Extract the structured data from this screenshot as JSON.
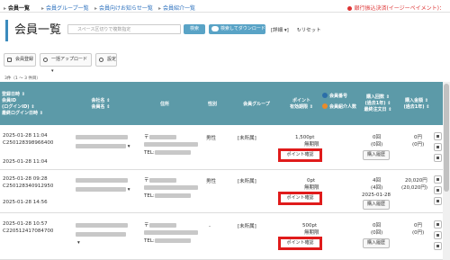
{
  "nav": {
    "items": [
      "会員一覧",
      "会員グループ一覧",
      "会員向けお知らせ一覧",
      "会員紹介一覧"
    ],
    "bank_notice": "銀行振込決済(イージーペイメント)："
  },
  "page_title": "会員一覧",
  "search": {
    "placeholder": "スペース区切りで複数指定",
    "button": "検索",
    "download": "検索してダウンロード",
    "detail": "[詳細 ▾]",
    "reset": "リセット"
  },
  "toolbar": {
    "register": "会員登録",
    "bulk_upload": "一括アップロード ▾",
    "settings": "設定"
  },
  "count_text": "3件（1 〜 3 件目）",
  "table": {
    "headers": {
      "reg": [
        "登録日時 ⇕",
        "会員ID",
        "(ログインID) ⇕",
        "最終ログイン日時 ⇕"
      ],
      "name": [
        "会社名 ⇕",
        "会員名 ⇕"
      ],
      "address": "住所",
      "gender": "性別",
      "group": "会員グループ",
      "point": [
        "ポイント",
        "有効期限 ⇕"
      ],
      "member_no": "会員番号",
      "company_member": "会員紹介人数",
      "purchase_count": [
        "購入回数 ⇕",
        "(過去1年) ⇕",
        "最終注文日 ⇕"
      ],
      "purchase_amount": [
        "購入金額 ⇕",
        "(過去1年) ⇕"
      ]
    },
    "rows": [
      {
        "reg_date": "2025-01-28 11:04",
        "member_id": "C2501283989664​00",
        "last_login": "2025-01-28 11:04",
        "postal": "〒",
        "tel": "TEL:",
        "gender": "男性",
        "group": "[未所属]",
        "point": "1,500pt",
        "point_exp": "無期限",
        "point_btn": "ポイント確認",
        "count": "0回",
        "count_year": "(0回)",
        "last_order": "",
        "amount": "0円",
        "amount_year": "(0円)",
        "hist_btn": "購入履歴"
      },
      {
        "reg_date": "2025-01-28 09:28",
        "member_id": "C2501283409129​50",
        "last_login": "2025-01-28 14:56",
        "postal": "〒",
        "tel": "TEL:",
        "gender": "男性",
        "group": "[未所属]",
        "point": "0pt",
        "point_exp": "無期限",
        "point_btn": "ポイント確認",
        "count": "4回",
        "count_year": "(4回)",
        "last_order": "2025-01-28",
        "amount": "20,020円",
        "amount_year": "(20,020円)",
        "hist_btn": "購入履歴"
      },
      {
        "reg_date": "2025-01-28 10:57",
        "member_id": "C2205124170847​00",
        "last_login": "",
        "postal": "〒",
        "tel": "TEL:",
        "gender": "-",
        "group": "[未所属]",
        "point": "500pt",
        "point_exp": "無期限",
        "point_btn": "ポイント確認",
        "count": "0回",
        "count_year": "(0回)",
        "last_order": "",
        "amount": "0円",
        "amount_year": "(0円)",
        "hist_btn": "購入履歴"
      }
    ]
  },
  "colors": {
    "header_bg": "#5c9aa8",
    "accent": "#59a3c6",
    "highlight": "#e01b1b"
  }
}
